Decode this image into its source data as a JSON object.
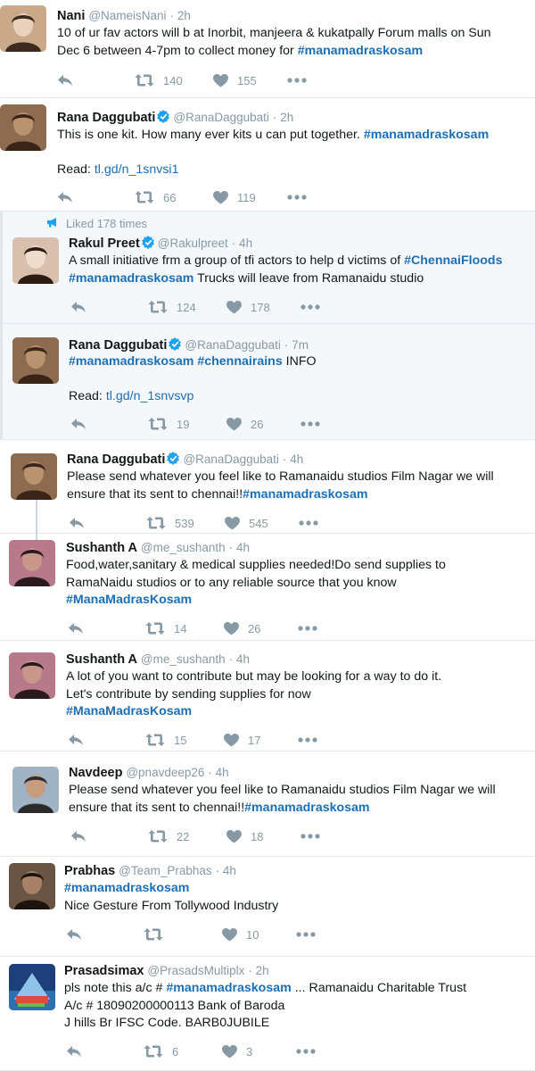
{
  "tweets": [
    {
      "name": "Nani",
      "handle": "@NameisNani",
      "dot": "·",
      "time": "2h",
      "verified": false,
      "lines": [
        {
          "text": "10 of ur fav actors will b at Inorbit, manjeera & kukatpally Forum malls on Sun"
        },
        {
          "text": "Dec 6 between 4-7pm to collect money for ",
          "tag": "#manamadraskosam"
        }
      ],
      "retweets": "140",
      "likes": "155"
    },
    {
      "name": "Rana Daggubati",
      "handle": "@RanaDaggubati",
      "dot": "·",
      "time": "2h",
      "verified": true,
      "lines": [
        {
          "text": "This is one kit. How many ever kits u can put together. ",
          "tag": "#manamadraskosam"
        },
        {
          "text": ""
        },
        {
          "text": "Read: ",
          "link": "tl.gd/n_1snvsi1"
        }
      ],
      "retweets": "66",
      "likes": "119"
    },
    {
      "context": "Liked 178 times",
      "name": "Rakul Preet",
      "handle": "@Rakulpreet",
      "dot": "·",
      "time": "4h",
      "verified": true,
      "lines": [
        {
          "text": "A small initiative frm a group of tfi actors to help d victims of ",
          "tag": "#ChennaiFloods"
        },
        {
          "text": "",
          "tag": "#manamadraskosam",
          "after": " Trucks will leave from Ramanaidu studio"
        }
      ],
      "retweets": "124",
      "likes": "178"
    },
    {
      "name": "Rana Daggubati",
      "handle": "@RanaDaggubati",
      "dot": "·",
      "time": "7m",
      "verified": true,
      "lines": [
        {
          "text": "",
          "tag": "#manamadraskosam #chennairains",
          "after": " INFO"
        },
        {
          "text": ""
        },
        {
          "text": "Read: ",
          "link": "tl.gd/n_1snvsvp"
        }
      ],
      "retweets": "19",
      "likes": "26"
    },
    {
      "name": "Rana Daggubati",
      "handle": "@RanaDaggubati",
      "dot": "·",
      "time": "4h",
      "verified": true,
      "lines": [
        {
          "text": "Please send whatever you feel like to Ramanaidu studios Film Nagar we will"
        },
        {
          "text": "ensure that its sent to chennai!!",
          "tag": "#manamadraskosam"
        }
      ],
      "retweets": "539",
      "likes": "545"
    },
    {
      "name": "Sushanth A",
      "handle": "@me_sushanth",
      "dot": "·",
      "time": "4h",
      "verified": false,
      "lines": [
        {
          "text": "Food,water,sanitary & medical supplies needed!Do send supplies to"
        },
        {
          "text": "RamaNaidu studios or to any reliable source that you know"
        },
        {
          "text": "",
          "tag": "#ManaMadrasKosam"
        }
      ],
      "retweets": "14",
      "likes": "26"
    },
    {
      "name": "Sushanth A",
      "handle": "@me_sushanth",
      "dot": "·",
      "time": "4h",
      "verified": false,
      "lines": [
        {
          "text": "A lot of you want to contribute but may be looking for a way to do it."
        },
        {
          "text": "Let's contribute by sending supplies for now"
        },
        {
          "text": "",
          "tag": "#ManaMadrasKosam"
        }
      ],
      "retweets": "15",
      "likes": "17"
    },
    {
      "name": "Navdeep",
      "handle": "@pnavdeep26",
      "dot": "·",
      "time": "4h",
      "verified": false,
      "lines": [
        {
          "text": "Please send whatever you feel like to Ramanaidu studios Film Nagar we will"
        },
        {
          "text": "ensure that its sent to chennai!!",
          "tag": "#manamadraskosam"
        }
      ],
      "retweets": "22",
      "likes": "18"
    },
    {
      "name": "Prabhas",
      "handle": "@Team_Prabhas",
      "dot": "·",
      "time": "4h",
      "verified": false,
      "lines": [
        {
          "text": "",
          "tag": "#manamadraskosam"
        },
        {
          "text": "Nice Gesture From Tollywood Industry"
        }
      ],
      "retweets": "",
      "likes": "10"
    },
    {
      "name": "Prasadsimax",
      "handle": "@PrasadsMultiplx",
      "dot": "·",
      "time": "2h",
      "verified": false,
      "lines": [
        {
          "text": "pls note this a/c # ",
          "tag": "#manamadraskosam",
          "after": "   ... Ramanaidu Charitable Trust"
        },
        {
          "text": "A/c # 18090200000113 Bank of Baroda"
        },
        {
          "text": "J hills Br IFSC Code. BARB0JUBILE"
        }
      ],
      "retweets": "6",
      "likes": "3"
    }
  ],
  "colors": {
    "link": "#1b6fb7",
    "meta": "#8899a6",
    "verified": "#1da1f2",
    "convBg": "#f5f8fa"
  },
  "icons": [
    "reply-icon",
    "retweet-icon",
    "heart-icon",
    "more-icon",
    "verified-icon",
    "megaphone-icon"
  ]
}
